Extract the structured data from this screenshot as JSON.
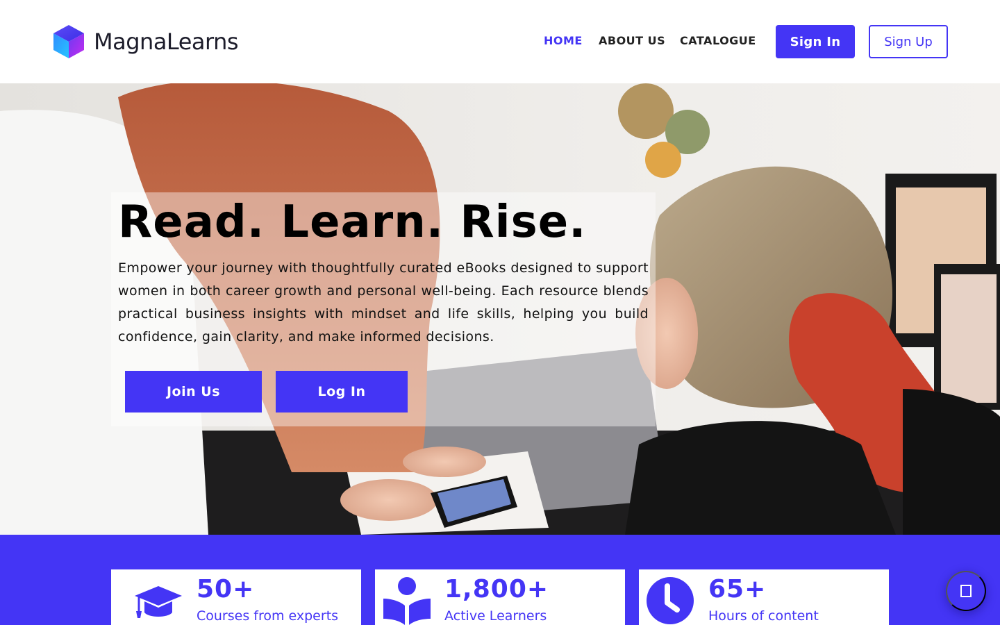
{
  "brand": {
    "name": "MagnaLearns"
  },
  "nav": {
    "items": [
      {
        "label": "HOME",
        "active": true
      },
      {
        "label": "ABOUT US",
        "active": false
      },
      {
        "label": "CATALOGUE",
        "active": false
      }
    ],
    "signin_label": "Sign In",
    "signup_label": "Sign Up"
  },
  "hero": {
    "title": "Read. Learn. Rise.",
    "description": "Empower your journey with thoughtfully curated eBooks designed to support women in both career growth and personal well-being. Each resource blends practical business insights with mindset and life skills, helping you build confidence, gain clarity, and make informed decisions.",
    "join_label": "Join Us",
    "login_label": "Log In"
  },
  "stats": [
    {
      "icon": "graduation-cap-icon",
      "value": "50+",
      "label": "Courses from experts"
    },
    {
      "icon": "book-reader-icon",
      "value": "1,800+",
      "label": "Active Learners"
    },
    {
      "icon": "clock-icon",
      "value": "65+",
      "label": "Hours of content"
    }
  ],
  "chat": {
    "icon": "chat-icon"
  },
  "colors": {
    "accent": "#4435f5",
    "text": "#111111",
    "background": "#ffffff"
  }
}
